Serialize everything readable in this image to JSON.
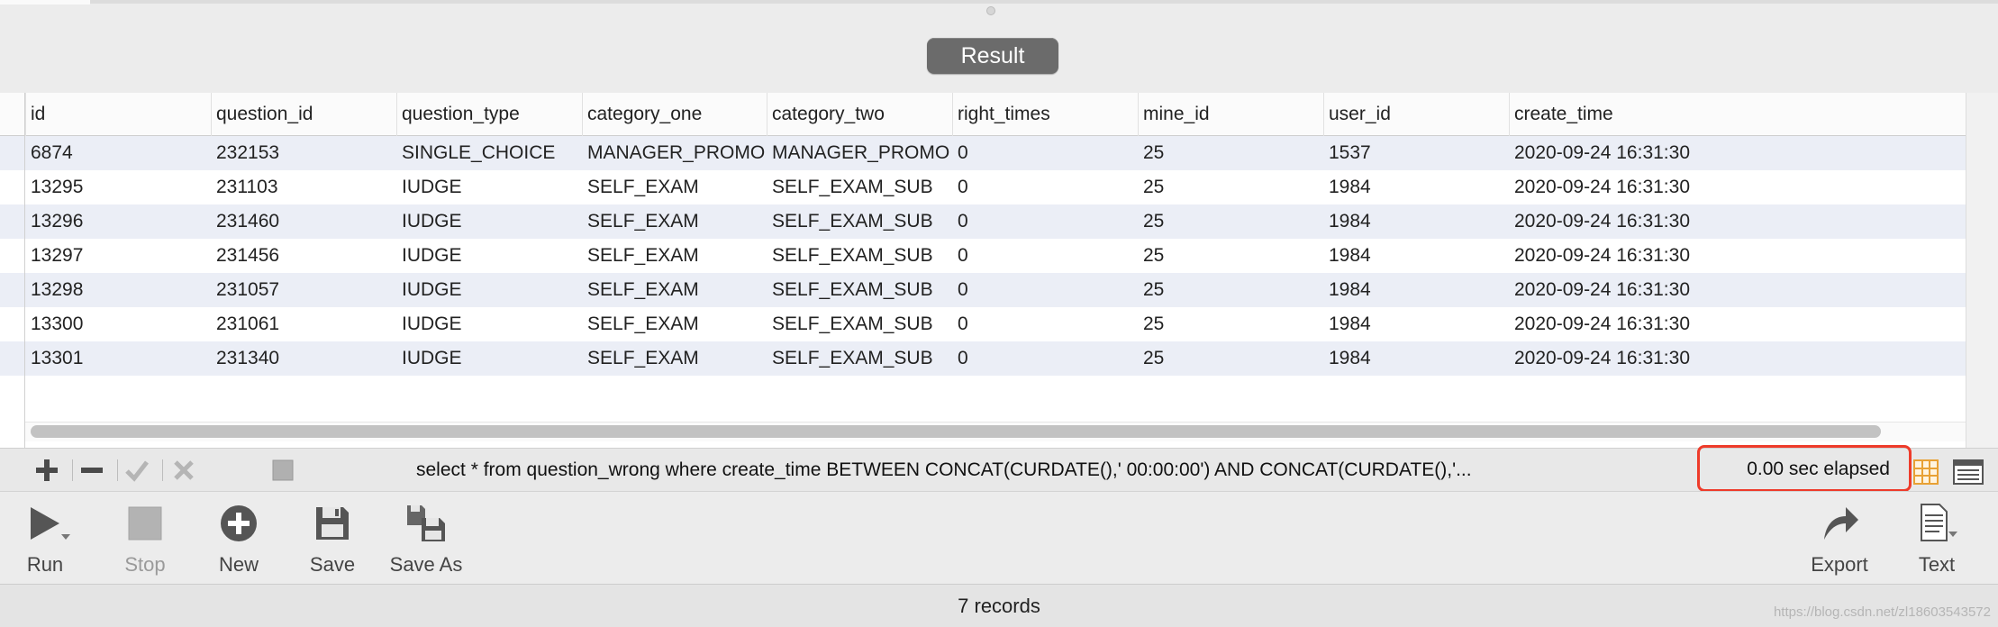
{
  "result_button": "Result",
  "columns": [
    "id",
    "question_id",
    "question_type",
    "category_one",
    "category_two",
    "right_times",
    "mine_id",
    "user_id",
    "create_time"
  ],
  "rows": [
    [
      "6874",
      "232153",
      "SINGLE_CHOICE",
      "MANAGER_PROMO",
      "MANAGER_PROMO",
      "0",
      "25",
      "1537",
      "2020-09-24 16:31:30"
    ],
    [
      "13295",
      "231103",
      "IUDGE",
      "SELF_EXAM",
      "SELF_EXAM_SUB",
      "0",
      "25",
      "1984",
      "2020-09-24 16:31:30"
    ],
    [
      "13296",
      "231460",
      "IUDGE",
      "SELF_EXAM",
      "SELF_EXAM_SUB",
      "0",
      "25",
      "1984",
      "2020-09-24 16:31:30"
    ],
    [
      "13297",
      "231456",
      "IUDGE",
      "SELF_EXAM",
      "SELF_EXAM_SUB",
      "0",
      "25",
      "1984",
      "2020-09-24 16:31:30"
    ],
    [
      "13298",
      "231057",
      "IUDGE",
      "SELF_EXAM",
      "SELF_EXAM_SUB",
      "0",
      "25",
      "1984",
      "2020-09-24 16:31:30"
    ],
    [
      "13300",
      "231061",
      "IUDGE",
      "SELF_EXAM",
      "SELF_EXAM_SUB",
      "0",
      "25",
      "1984",
      "2020-09-24 16:31:30"
    ],
    [
      "13301",
      "231340",
      "IUDGE",
      "SELF_EXAM",
      "SELF_EXAM_SUB",
      "0",
      "25",
      "1984",
      "2020-09-24 16:31:30"
    ]
  ],
  "query_bar": {
    "query": "select * from question_wrong where create_time BETWEEN CONCAT(CURDATE(),' 00:00:00') AND CONCAT(CURDATE(),'...",
    "elapsed": "0.00 sec elapsed",
    "highlight_color": "#ee3b2a"
  },
  "icons": {
    "add": "plus-icon",
    "remove": "minus-icon",
    "apply": "check-icon",
    "discard": "cross-icon",
    "stop_small": "square-icon",
    "grid_view": "grid-view-icon",
    "form_view": "form-view-icon"
  },
  "toolbar": {
    "run": "Run",
    "stop": "Stop",
    "new": "New",
    "save": "Save",
    "save_as": "Save As",
    "export": "Export",
    "text": "Text"
  },
  "status": {
    "records": "7 records",
    "watermark": "https://blog.csdn.net/zl18603543572"
  }
}
